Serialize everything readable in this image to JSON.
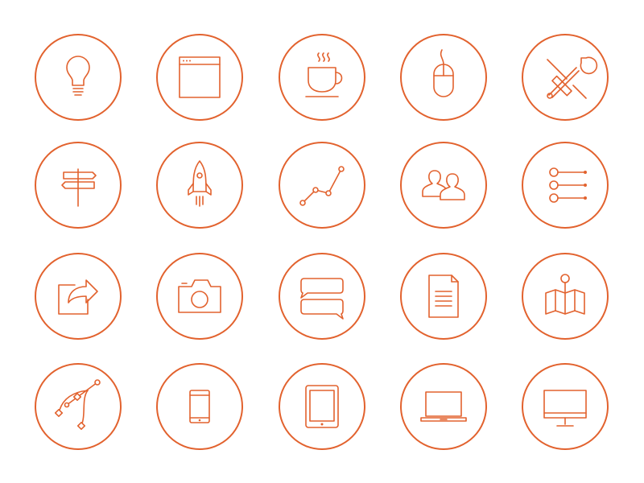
{
  "colors": {
    "accent": "#e2622e",
    "background": "#ffffff"
  },
  "icons": [
    {
      "row": 1,
      "name": "lightbulb-icon"
    },
    {
      "row": 1,
      "name": "browser-window-icon"
    },
    {
      "row": 1,
      "name": "coffee-cup-icon"
    },
    {
      "row": 1,
      "name": "computer-mouse-icon"
    },
    {
      "row": 1,
      "name": "tools-wrench-screwdriver-icon"
    },
    {
      "row": 2,
      "name": "signpost-icon"
    },
    {
      "row": 2,
      "name": "rocket-icon"
    },
    {
      "row": 2,
      "name": "line-graph-icon"
    },
    {
      "row": 2,
      "name": "users-icon"
    },
    {
      "row": 2,
      "name": "list-options-icon"
    },
    {
      "row": 3,
      "name": "share-export-icon"
    },
    {
      "row": 3,
      "name": "camera-icon"
    },
    {
      "row": 3,
      "name": "chat-bubbles-icon"
    },
    {
      "row": 3,
      "name": "document-icon"
    },
    {
      "row": 3,
      "name": "map-pin-icon"
    },
    {
      "row": 4,
      "name": "bezier-curve-icon"
    },
    {
      "row": 4,
      "name": "smartphone-icon"
    },
    {
      "row": 4,
      "name": "tablet-icon"
    },
    {
      "row": 4,
      "name": "laptop-icon"
    },
    {
      "row": 4,
      "name": "desktop-monitor-icon"
    }
  ]
}
